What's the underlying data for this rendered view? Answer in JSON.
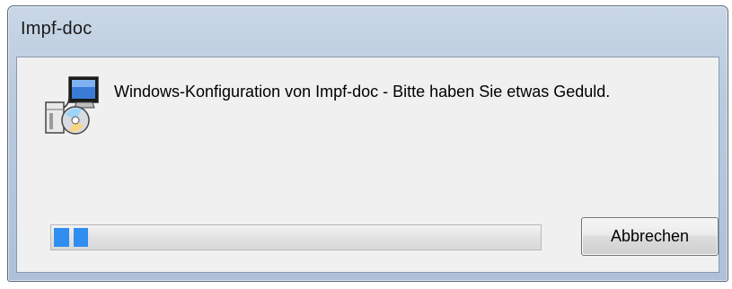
{
  "window": {
    "title": "Impf-doc"
  },
  "dialog": {
    "icon": "installer-icon",
    "message": "Windows-Konfiguration von Impf-doc - Bitte haben Sie etwas Geduld.",
    "progress_fraction": 0.07,
    "cancel_label": "Abbrechen"
  },
  "colors": {
    "progress_fill": "#2f8ef0",
    "client_background": "#f0f0f0",
    "title_background": "#b9cade"
  }
}
